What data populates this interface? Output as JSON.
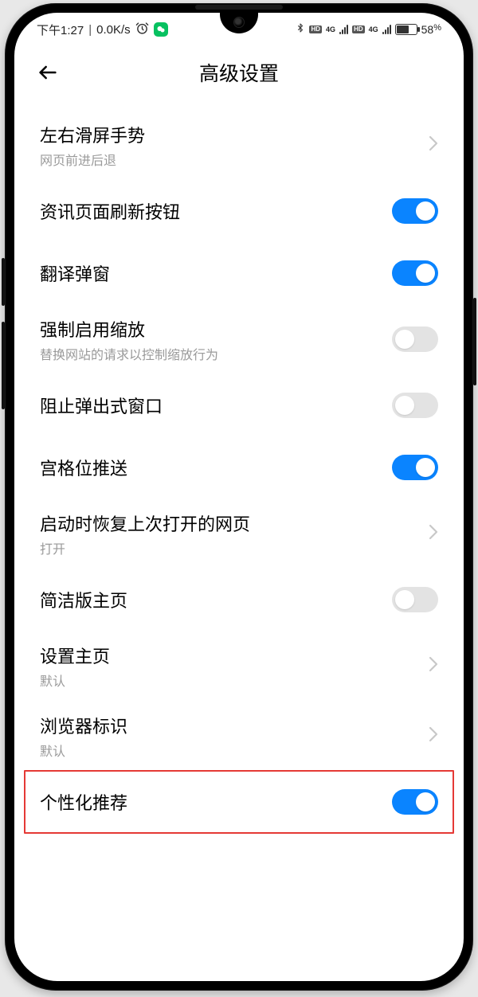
{
  "status": {
    "time": "下午1:27",
    "speed": "0.0K/s",
    "net_label": "4G",
    "battery_pct": "58",
    "pct_suffix": "%"
  },
  "header": {
    "title": "高级设置"
  },
  "rows": [
    {
      "label": "左右滑屏手势",
      "sub": "网页前进后退"
    },
    {
      "label": "资讯页面刷新按钮"
    },
    {
      "label": "翻译弹窗"
    },
    {
      "label": "强制启用缩放",
      "sub": "替换网站的请求以控制缩放行为"
    },
    {
      "label": "阻止弹出式窗口"
    },
    {
      "label": "宫格位推送"
    },
    {
      "label": "启动时恢复上次打开的网页",
      "sub": "打开"
    },
    {
      "label": "简洁版主页"
    },
    {
      "label": "设置主页",
      "sub": "默认"
    },
    {
      "label": "浏览器标识",
      "sub": "默认"
    },
    {
      "label": "个性化推荐"
    }
  ]
}
